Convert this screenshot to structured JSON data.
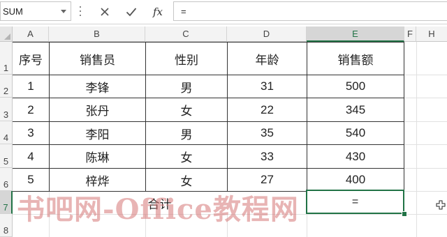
{
  "formula_bar": {
    "name_box": "SUM",
    "fx_label": "fx",
    "formula": "="
  },
  "columns": [
    "A",
    "B",
    "C",
    "D",
    "E",
    "F",
    "H"
  ],
  "row_numbers": [
    "1",
    "2",
    "3",
    "4",
    "5",
    "6",
    "7",
    "8"
  ],
  "table": {
    "headers": [
      "序号",
      "销售员",
      "性别",
      "年龄",
      "销售额"
    ],
    "rows": [
      [
        "1",
        "李锋",
        "男",
        "31",
        "500"
      ],
      [
        "2",
        "张丹",
        "女",
        "22",
        "345"
      ],
      [
        "3",
        "李阳",
        "男",
        "35",
        "540"
      ],
      [
        "4",
        "陈琳",
        "女",
        "33",
        "430"
      ],
      [
        "5",
        "梓烨",
        "女",
        "27",
        "400"
      ]
    ],
    "total_label": "合计",
    "total_value": "="
  },
  "active_cell": {
    "column": "E",
    "row": "7"
  },
  "watermark": "书吧网-Office教程网",
  "colors": {
    "excel_green": "#217346",
    "watermark": "#d67676"
  },
  "icons": [
    "chevron-down-icon",
    "cancel-x-icon",
    "enter-check-icon",
    "fx-icon",
    "cell-cursor-icon"
  ]
}
